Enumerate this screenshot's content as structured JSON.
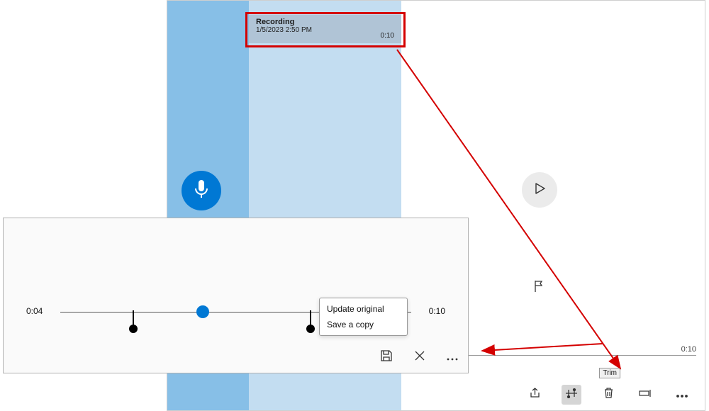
{
  "recording": {
    "title": "Recording",
    "datetime": "1/5/2023 2:50 PM",
    "duration": "0:10"
  },
  "trim_tooltip": "Trim",
  "track_duration": "0:10",
  "trim_editor": {
    "start_time": "0:04",
    "end_time": "0:10",
    "menu": {
      "update": "Update original",
      "copy": "Save a copy"
    }
  }
}
